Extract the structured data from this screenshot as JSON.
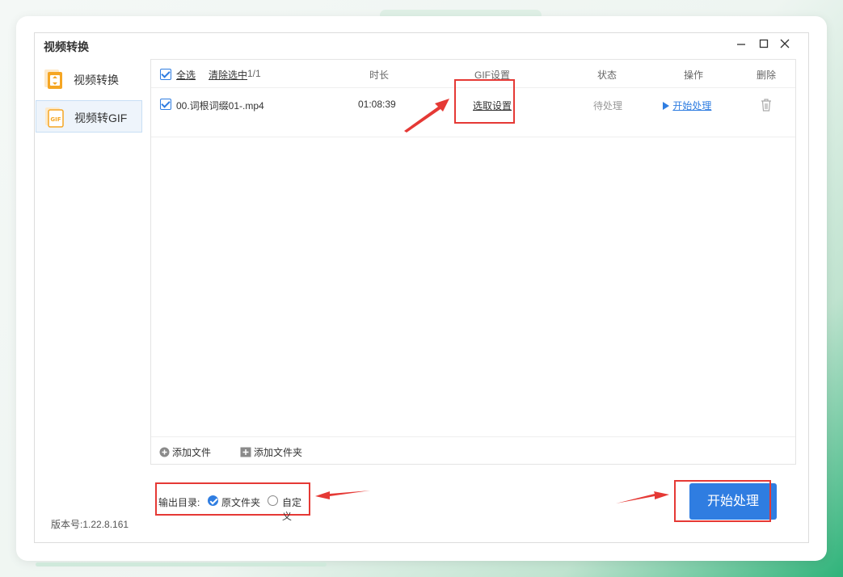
{
  "window": {
    "title": "视频转换"
  },
  "sidebar": {
    "items": [
      {
        "label": "视频转换",
        "icon": "video-convert-icon",
        "active": false
      },
      {
        "label": "视频转GIF",
        "icon": "gif-icon",
        "active": true
      }
    ]
  },
  "table": {
    "headers": {
      "select_all": "全选",
      "clear_selected": "清除选中",
      "count": "1/1",
      "duration": "时长",
      "gif_settings": "GIF设置",
      "status": "状态",
      "action": "操作",
      "delete": "删除"
    },
    "rows": [
      {
        "filename": "00.词根词缀01-.mp4",
        "duration": "01:08:39",
        "settings_link": "选取设置",
        "status": "待处理",
        "action_link": "开始处理"
      }
    ]
  },
  "footer": {
    "add_file": "添加文件",
    "add_folder": "添加文件夹"
  },
  "output": {
    "label": "输出目录:",
    "options": [
      "原文件夹",
      "自定义"
    ],
    "selected": "原文件夹"
  },
  "start_button": "开始处理",
  "version": "版本号:1.22.8.161",
  "colors": {
    "accent": "#2f7de1",
    "annotation": "#e53935"
  }
}
